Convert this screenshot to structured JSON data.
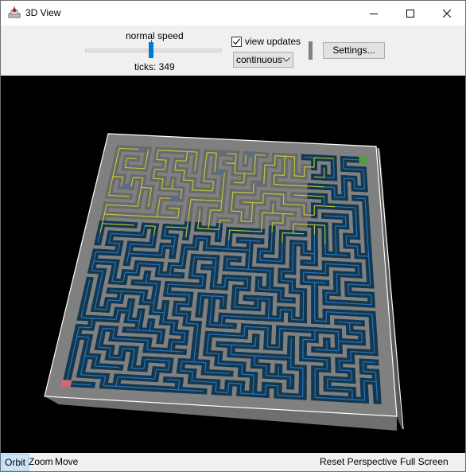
{
  "window": {
    "title": "3D View",
    "controls": {
      "minimize": "minimize-icon",
      "maximize": "maximize-icon",
      "close": "close-icon"
    }
  },
  "toolbar": {
    "speed_label": "normal speed",
    "speed_slider_value": 0.5,
    "ticks_label": "ticks: 349",
    "view_updates_label": "view updates",
    "view_updates_checked": true,
    "update_mode": "continuous",
    "settings_label": "Settings..."
  },
  "scene": {
    "board_color": "#808080",
    "corridor_color": "#12384f",
    "trace_yellow": "#c8d23a",
    "trace_blue": "#2f78c8",
    "start_color": "#d06a6a",
    "goal_color": "#4aa23a",
    "grid_size": 26
  },
  "statusbar": {
    "orbit": "Orbit",
    "zoom": "Zoom",
    "move": "Move",
    "reset": "Reset Perspective",
    "fullscreen": "Full Screen"
  }
}
